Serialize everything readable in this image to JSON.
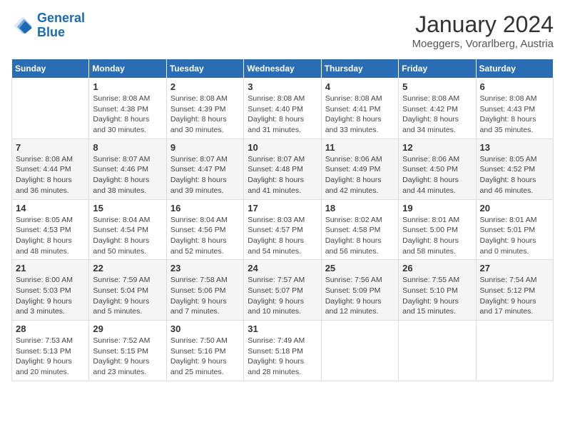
{
  "header": {
    "logo_line1": "General",
    "logo_line2": "Blue",
    "month_title": "January 2024",
    "location": "Moeggers, Vorarlberg, Austria"
  },
  "days_of_week": [
    "Sunday",
    "Monday",
    "Tuesday",
    "Wednesday",
    "Thursday",
    "Friday",
    "Saturday"
  ],
  "weeks": [
    [
      {
        "num": "",
        "info": ""
      },
      {
        "num": "1",
        "info": "Sunrise: 8:08 AM\nSunset: 4:38 PM\nDaylight: 8 hours\nand 30 minutes."
      },
      {
        "num": "2",
        "info": "Sunrise: 8:08 AM\nSunset: 4:39 PM\nDaylight: 8 hours\nand 30 minutes."
      },
      {
        "num": "3",
        "info": "Sunrise: 8:08 AM\nSunset: 4:40 PM\nDaylight: 8 hours\nand 31 minutes."
      },
      {
        "num": "4",
        "info": "Sunrise: 8:08 AM\nSunset: 4:41 PM\nDaylight: 8 hours\nand 33 minutes."
      },
      {
        "num": "5",
        "info": "Sunrise: 8:08 AM\nSunset: 4:42 PM\nDaylight: 8 hours\nand 34 minutes."
      },
      {
        "num": "6",
        "info": "Sunrise: 8:08 AM\nSunset: 4:43 PM\nDaylight: 8 hours\nand 35 minutes."
      }
    ],
    [
      {
        "num": "7",
        "info": "Sunrise: 8:08 AM\nSunset: 4:44 PM\nDaylight: 8 hours\nand 36 minutes."
      },
      {
        "num": "8",
        "info": "Sunrise: 8:07 AM\nSunset: 4:46 PM\nDaylight: 8 hours\nand 38 minutes."
      },
      {
        "num": "9",
        "info": "Sunrise: 8:07 AM\nSunset: 4:47 PM\nDaylight: 8 hours\nand 39 minutes."
      },
      {
        "num": "10",
        "info": "Sunrise: 8:07 AM\nSunset: 4:48 PM\nDaylight: 8 hours\nand 41 minutes."
      },
      {
        "num": "11",
        "info": "Sunrise: 8:06 AM\nSunset: 4:49 PM\nDaylight: 8 hours\nand 42 minutes."
      },
      {
        "num": "12",
        "info": "Sunrise: 8:06 AM\nSunset: 4:50 PM\nDaylight: 8 hours\nand 44 minutes."
      },
      {
        "num": "13",
        "info": "Sunrise: 8:05 AM\nSunset: 4:52 PM\nDaylight: 8 hours\nand 46 minutes."
      }
    ],
    [
      {
        "num": "14",
        "info": "Sunrise: 8:05 AM\nSunset: 4:53 PM\nDaylight: 8 hours\nand 48 minutes."
      },
      {
        "num": "15",
        "info": "Sunrise: 8:04 AM\nSunset: 4:54 PM\nDaylight: 8 hours\nand 50 minutes."
      },
      {
        "num": "16",
        "info": "Sunrise: 8:04 AM\nSunset: 4:56 PM\nDaylight: 8 hours\nand 52 minutes."
      },
      {
        "num": "17",
        "info": "Sunrise: 8:03 AM\nSunset: 4:57 PM\nDaylight: 8 hours\nand 54 minutes."
      },
      {
        "num": "18",
        "info": "Sunrise: 8:02 AM\nSunset: 4:58 PM\nDaylight: 8 hours\nand 56 minutes."
      },
      {
        "num": "19",
        "info": "Sunrise: 8:01 AM\nSunset: 5:00 PM\nDaylight: 8 hours\nand 58 minutes."
      },
      {
        "num": "20",
        "info": "Sunrise: 8:01 AM\nSunset: 5:01 PM\nDaylight: 9 hours\nand 0 minutes."
      }
    ],
    [
      {
        "num": "21",
        "info": "Sunrise: 8:00 AM\nSunset: 5:03 PM\nDaylight: 9 hours\nand 3 minutes."
      },
      {
        "num": "22",
        "info": "Sunrise: 7:59 AM\nSunset: 5:04 PM\nDaylight: 9 hours\nand 5 minutes."
      },
      {
        "num": "23",
        "info": "Sunrise: 7:58 AM\nSunset: 5:06 PM\nDaylight: 9 hours\nand 7 minutes."
      },
      {
        "num": "24",
        "info": "Sunrise: 7:57 AM\nSunset: 5:07 PM\nDaylight: 9 hours\nand 10 minutes."
      },
      {
        "num": "25",
        "info": "Sunrise: 7:56 AM\nSunset: 5:09 PM\nDaylight: 9 hours\nand 12 minutes."
      },
      {
        "num": "26",
        "info": "Sunrise: 7:55 AM\nSunset: 5:10 PM\nDaylight: 9 hours\nand 15 minutes."
      },
      {
        "num": "27",
        "info": "Sunrise: 7:54 AM\nSunset: 5:12 PM\nDaylight: 9 hours\nand 17 minutes."
      }
    ],
    [
      {
        "num": "28",
        "info": "Sunrise: 7:53 AM\nSunset: 5:13 PM\nDaylight: 9 hours\nand 20 minutes."
      },
      {
        "num": "29",
        "info": "Sunrise: 7:52 AM\nSunset: 5:15 PM\nDaylight: 9 hours\nand 23 minutes."
      },
      {
        "num": "30",
        "info": "Sunrise: 7:50 AM\nSunset: 5:16 PM\nDaylight: 9 hours\nand 25 minutes."
      },
      {
        "num": "31",
        "info": "Sunrise: 7:49 AM\nSunset: 5:18 PM\nDaylight: 9 hours\nand 28 minutes."
      },
      {
        "num": "",
        "info": ""
      },
      {
        "num": "",
        "info": ""
      },
      {
        "num": "",
        "info": ""
      }
    ]
  ]
}
